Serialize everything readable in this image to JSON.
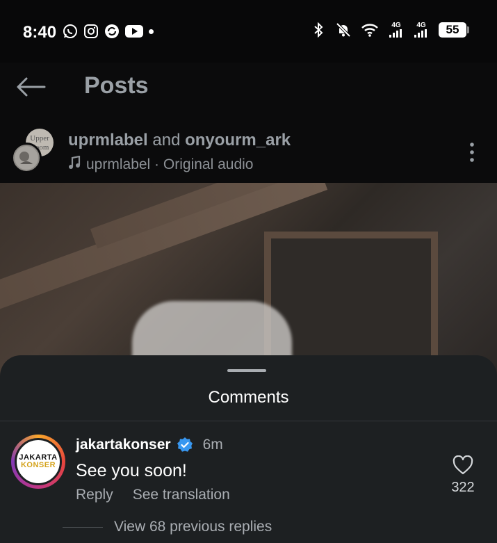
{
  "status_bar": {
    "time": "8:40",
    "left_icons": [
      "whatsapp-icon",
      "instagram-icon",
      "sync-icon",
      "youtube-icon",
      "notification-dot"
    ],
    "right_icons": [
      "bluetooth-icon",
      "mute-icon",
      "wifi-icon",
      "signal-4g-icon",
      "signal-4g-icon"
    ],
    "network_1": "4G",
    "network_2": "4G",
    "battery": "55"
  },
  "top_bar": {
    "title": "Posts"
  },
  "post_header": {
    "user_1": "uprmlabel",
    "joiner": " and ",
    "user_2": "onyourm_ark",
    "audio_user": "uprmlabel",
    "audio_sep": " · ",
    "audio_label": "Original audio",
    "avatar_text_line1": "Upper",
    "avatar_text_line2": "Room"
  },
  "comments_sheet": {
    "title": "Comments",
    "comment": {
      "username": "jakartakonser",
      "time": "6m",
      "text": "See you soon!",
      "reply_label": "Reply",
      "translate_label": "See translation",
      "like_count": "322",
      "avatar_line1": "JAKARTA",
      "avatar_line2": "KONSER"
    },
    "view_replies": "View 68 previous replies"
  },
  "colors": {
    "background": "#0b0b0c",
    "sheet": "#1d2022",
    "verified": "#3897f0",
    "muted_text": "#a9adb2"
  }
}
